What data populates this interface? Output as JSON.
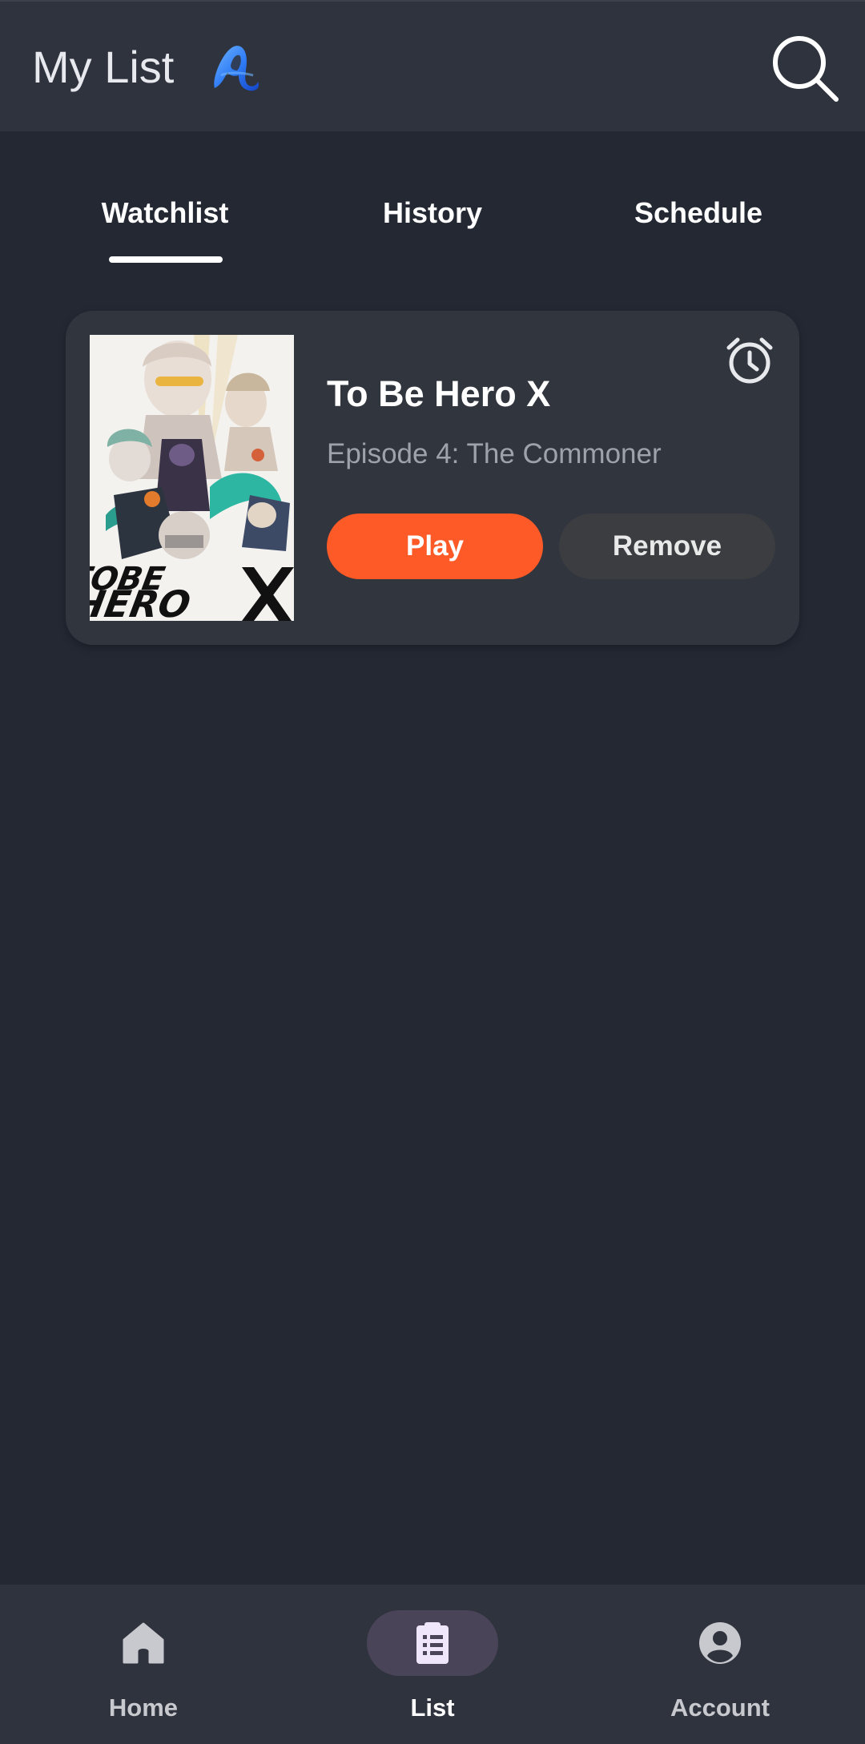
{
  "header": {
    "title": "My List",
    "logo_icon": "blue-a-logo-icon",
    "search_icon": "search-icon"
  },
  "tabs": [
    {
      "label": "Watchlist",
      "selected": true
    },
    {
      "label": "History",
      "selected": false
    },
    {
      "label": "Schedule",
      "selected": false
    }
  ],
  "watchlist": [
    {
      "title": "To Be Hero X",
      "episode": "Episode 4: The Commoner",
      "poster_logo_text": "TOBE HERO X",
      "reminder_icon": "alarm-clock-icon",
      "play_label": "Play",
      "remove_label": "Remove"
    }
  ],
  "bottom_nav": [
    {
      "label": "Home",
      "icon": "home-icon",
      "active": false
    },
    {
      "label": "List",
      "icon": "clipboard-list-icon",
      "active": true
    },
    {
      "label": "Account",
      "icon": "account-circle-icon",
      "active": false
    }
  ],
  "colors": {
    "background": "#232833",
    "bar": "#2f333d",
    "card": "#31353e",
    "accent": "#fe5a28",
    "remove_button": "#3b3d41",
    "nav_active_pill": "#4a4459",
    "logo_blue": "#2f7cf6"
  }
}
